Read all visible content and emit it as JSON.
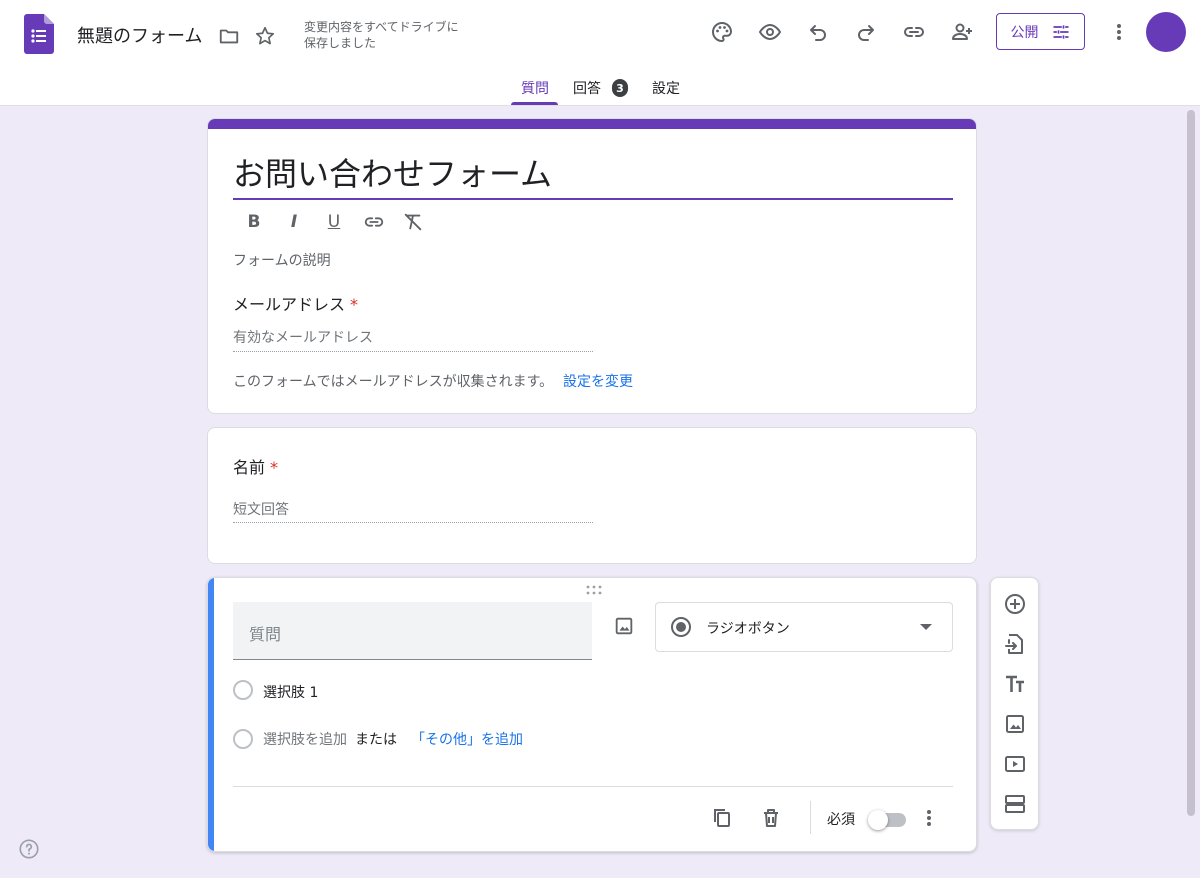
{
  "header": {
    "doc_title": "無題のフォーム",
    "save_status_line1": "変更内容をすべてドライブに",
    "save_status_line2": "保存しました",
    "publish_label": "公開",
    "icons": [
      "folder-icon",
      "star-icon",
      "palette-icon",
      "eye-icon",
      "undo-icon",
      "redo-icon",
      "link-icon",
      "add-person-icon",
      "more-vert-icon"
    ]
  },
  "tabs": [
    {
      "label": "質問",
      "active": true
    },
    {
      "label": "回答",
      "badge": "3"
    },
    {
      "label": "設定"
    }
  ],
  "form": {
    "title": "お問い合わせフォーム",
    "format_buttons": [
      "B",
      "I",
      "U"
    ],
    "description_placeholder": "フォームの説明",
    "email_question": {
      "label": "メールアドレス",
      "required_mark": "*",
      "placeholder": "有効なメールアドレス"
    },
    "email_note": "このフォームではメールアドレスが収集されます。",
    "settings_link": "設定を変更"
  },
  "name_question": {
    "label": "名前",
    "required_mark": "*",
    "answer_placeholder": "短文回答"
  },
  "active_question": {
    "question_placeholder": "質問",
    "type_label": "ラジオボタン",
    "option1": "選択肢 1",
    "add_option": "選択肢を追加",
    "or_text": "または",
    "add_other": "「その他」を追加",
    "required_label": "必須",
    "required_on": false
  },
  "colors": {
    "accent": "#673ab7",
    "background": "#efeaf8",
    "active_bar": "#4285f4",
    "link": "#1a73e8",
    "required": "#d93025"
  }
}
